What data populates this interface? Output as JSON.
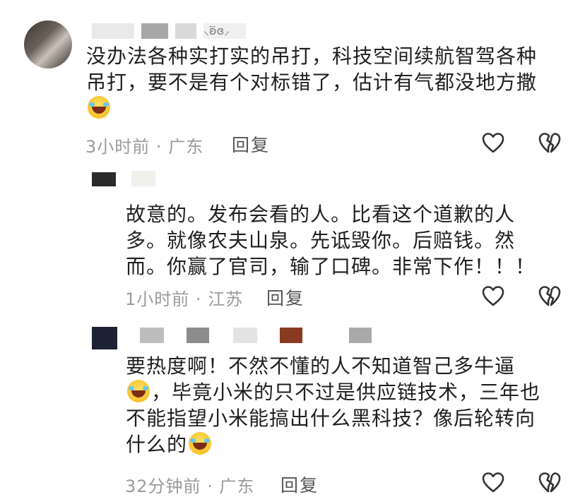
{
  "comments": [
    {
      "text_lines": [
        "没办法各种实打实的吊打，科技空间续航智驾各种",
        "吊打，要不是有个对标错了，估计有气都没地方撒"
      ],
      "time": "3小时前",
      "location": "广东",
      "separator": "·",
      "reply_label": "回复",
      "name_suffix": "⸜ʚ⃛ɞ⸝",
      "emoji_after_text": true
    },
    {
      "text_lines": [
        "故意的。发布会看的人。比看这个道歉的人",
        "多。就像农夫山泉。先诋毁你。后赔钱。然",
        "而。你赢了官司，输了口碑。非常下作！！！"
      ],
      "time": "1小时前",
      "location": "江苏",
      "separator": "·",
      "reply_label": "回复"
    },
    {
      "text_line1": "要热度啊！不然不懂的人不知道智己多牛逼",
      "text_line2": "，毕竟小米的只不过是供应链技术，三年也",
      "text_line3": "不能指望小米能搞出什么黑科技？像后轮转向",
      "text_line4": "什么的",
      "time": "32分钟前",
      "location": "广东",
      "separator": "·",
      "reply_label": "回复"
    }
  ],
  "icons": {
    "like": "heart-outline-icon",
    "dislike": "broken-heart-icon",
    "emoji": "laughing-crying-emoji"
  },
  "colors": {
    "text": "#1f1f1f",
    "meta": "#9a9a9a",
    "reply": "#555555",
    "icon": "#333333"
  }
}
